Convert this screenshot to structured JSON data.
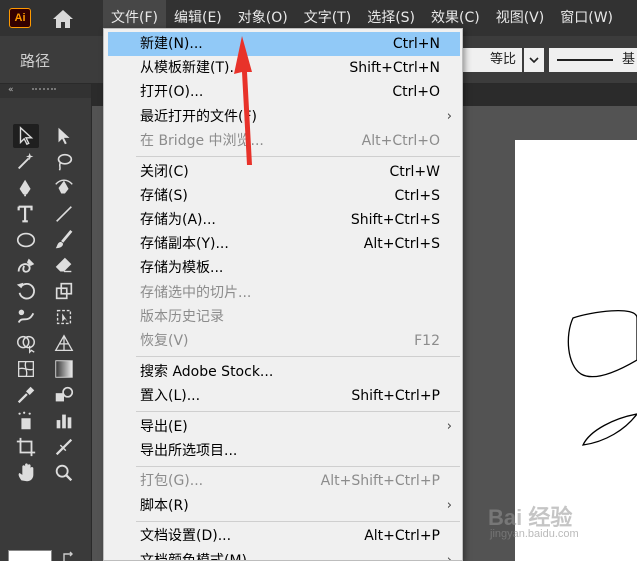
{
  "app": {
    "logo_text": "Ai"
  },
  "menubar": {
    "items": [
      {
        "label": "文件(F)"
      },
      {
        "label": "编辑(E)"
      },
      {
        "label": "对象(O)"
      },
      {
        "label": "文字(T)"
      },
      {
        "label": "选择(S)"
      },
      {
        "label": "效果(C)"
      },
      {
        "label": "视图(V)"
      },
      {
        "label": "窗口(W)"
      }
    ]
  },
  "controlbar": {
    "path_label": "路径",
    "uniform_label": "等比",
    "stroke_label": "基"
  },
  "file_menu": {
    "groups": [
      [
        {
          "label": "新建(N)...",
          "shortcut": "Ctrl+N",
          "highlight": true
        },
        {
          "label": "从模板新建(T)...",
          "shortcut": "Shift+Ctrl+N"
        },
        {
          "label": "打开(O)...",
          "shortcut": "Ctrl+O"
        },
        {
          "label": "最近打开的文件(F)",
          "shortcut": "",
          "submenu": true
        },
        {
          "label": "在 Bridge 中浏览...",
          "shortcut": "Alt+Ctrl+O",
          "disabled": true
        }
      ],
      [
        {
          "label": "关闭(C)",
          "shortcut": "Ctrl+W"
        },
        {
          "label": "存储(S)",
          "shortcut": "Ctrl+S"
        },
        {
          "label": "存储为(A)...",
          "shortcut": "Shift+Ctrl+S"
        },
        {
          "label": "存储副本(Y)...",
          "shortcut": "Alt+Ctrl+S"
        },
        {
          "label": "存储为模板...",
          "shortcut": ""
        },
        {
          "label": "存储选中的切片...",
          "shortcut": "",
          "disabled": true
        },
        {
          "label": "版本历史记录",
          "shortcut": "",
          "disabled": true
        },
        {
          "label": "恢复(V)",
          "shortcut": "F12",
          "disabled": true
        }
      ],
      [
        {
          "label": "搜索 Adobe Stock...",
          "shortcut": ""
        },
        {
          "label": "置入(L)...",
          "shortcut": "Shift+Ctrl+P"
        }
      ],
      [
        {
          "label": "导出(E)",
          "shortcut": "",
          "submenu": true
        },
        {
          "label": "导出所选项目...",
          "shortcut": ""
        }
      ],
      [
        {
          "label": "打包(G)...",
          "shortcut": "Alt+Shift+Ctrl+P",
          "disabled": true
        },
        {
          "label": "脚本(R)",
          "shortcut": "",
          "submenu": true
        }
      ],
      [
        {
          "label": "文档设置(D)...",
          "shortcut": "Alt+Ctrl+P"
        },
        {
          "label": "文档颜色模式(M)",
          "shortcut": "",
          "submenu": true
        }
      ]
    ]
  },
  "tools": [
    "selection-tool",
    "direct-selection-tool",
    "magic-wand-tool",
    "lasso-tool",
    "pen-tool",
    "curvature-tool",
    "type-tool",
    "line-segment-tool",
    "ellipse-tool",
    "paintbrush-tool",
    "shaper-tool",
    "eraser-tool",
    "rotate-tool",
    "scale-tool",
    "puppet-warp-tool",
    "free-transform-tool",
    "shape-builder-tool",
    "perspective-grid-tool",
    "mesh-tool",
    "gradient-tool",
    "eyedropper-tool",
    "blend-tool",
    "symbol-sprayer-tool",
    "column-graph-tool",
    "artboard-tool",
    "slice-tool",
    "hand-tool",
    "zoom-tool"
  ],
  "watermark": {
    "text": "Bai 经验",
    "sub": "jingyan.baidu.com"
  },
  "colors": {
    "highlight": "#91c9f7",
    "annotation": "#e8322a",
    "ai_orange": "#ff9a00"
  }
}
